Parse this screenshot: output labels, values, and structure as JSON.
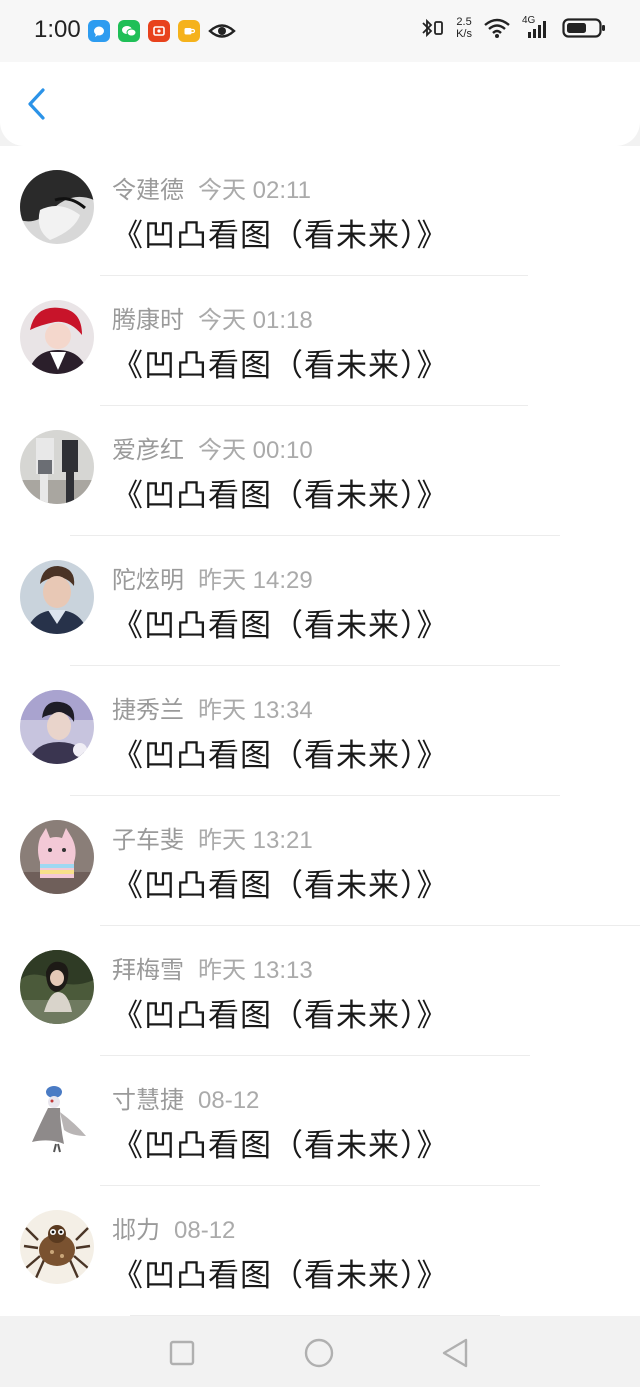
{
  "status_bar": {
    "time": "1:00",
    "net_speed_value": "2.5",
    "net_speed_unit": "K/s",
    "network_label": "4G",
    "apps": [
      {
        "icon": "qq-icon",
        "color": "#2d9cf0"
      },
      {
        "icon": "wechat-icon",
        "color": "#1fbf57"
      },
      {
        "icon": "shopping-app-icon",
        "color": "#e8421c"
      },
      {
        "icon": "coffee-app-icon",
        "color": "#f5b21b"
      }
    ]
  },
  "header": {
    "back_icon": "chevron-left-icon"
  },
  "colors": {
    "accent": "#2b93e8",
    "name_text": "#9a9a9a",
    "content_text": "#1a1a1a"
  },
  "messages": [
    {
      "name": "令建德",
      "time": "今天 02:11",
      "content": "《凹凸看图（看未来）》"
    },
    {
      "name": "腾康时",
      "time": "今天 01:18",
      "content": "《凹凸看图（看未来）》"
    },
    {
      "name": "爱彦红",
      "time": "今天 00:10",
      "content": "《凹凸看图（看未来）》"
    },
    {
      "name": "陀炫明",
      "time": "昨天 14:29",
      "content": "《凹凸看图（看未来）》"
    },
    {
      "name": "捷秀兰",
      "time": "昨天 13:34",
      "content": "《凹凸看图（看未来）》"
    },
    {
      "name": "子车斐",
      "time": "昨天 13:21",
      "content": "《凹凸看图（看未来）》"
    },
    {
      "name": "拜梅雪",
      "time": "昨天 13:13",
      "content": "《凹凸看图（看未来）》"
    },
    {
      "name": "寸慧捷",
      "time": "08-12",
      "content": "《凹凸看图（看未来）》"
    },
    {
      "name": "邶力",
      "time": "08-12",
      "content": "《凹凸看图（看未来）》"
    }
  ],
  "nav_bar": {
    "buttons": [
      "recent-apps-icon",
      "home-icon",
      "back-triangle-icon"
    ]
  }
}
